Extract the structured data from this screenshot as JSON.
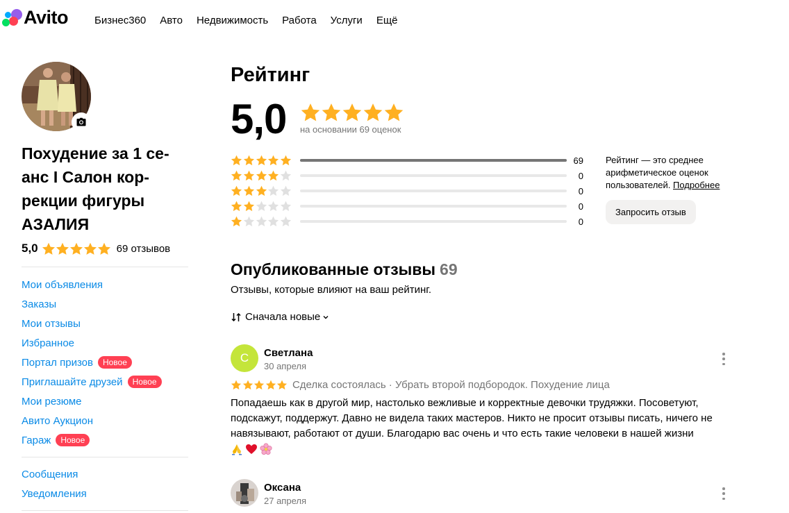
{
  "brand": {
    "logo_text": "Avito"
  },
  "nav": [
    "Бизнес360",
    "Авто",
    "Недвижимость",
    "Работа",
    "Услуги",
    "Ещё"
  ],
  "profile": {
    "title": "Похудение за 1 се-анс I Салон кор-рекции фигуры АЗАЛИЯ",
    "title_lines": [
      "Похудение за 1 се-",
      "анс I Салон кор-",
      "рекции фигуры",
      "АЗАЛИЯ"
    ],
    "rating": "5,0",
    "reviews_label": "69 отзывов"
  },
  "sidebar": {
    "links": [
      {
        "label": "Мои объявления",
        "badge": ""
      },
      {
        "label": "Заказы",
        "badge": ""
      },
      {
        "label": "Мои отзывы",
        "badge": ""
      },
      {
        "label": "Избранное",
        "badge": ""
      },
      {
        "label": "Портал призов",
        "badge": "Новое"
      },
      {
        "label": "Приглашайте друзей",
        "badge": "Новое"
      },
      {
        "label": "Мои резюме",
        "badge": ""
      },
      {
        "label": "Авито Аукцион",
        "badge": ""
      },
      {
        "label": "Гараж",
        "badge": "Новое"
      }
    ],
    "links2": [
      {
        "label": "Сообщения"
      },
      {
        "label": "Уведомления"
      }
    ]
  },
  "rating_block": {
    "heading": "Рейтинг",
    "score": "5,0",
    "based_on": "на основании 69 оценок",
    "distribution": [
      {
        "stars": 5,
        "count": "69",
        "fraction": 1.0
      },
      {
        "stars": 4,
        "count": "0",
        "fraction": 0
      },
      {
        "stars": 3,
        "count": "0",
        "fraction": 0
      },
      {
        "stars": 2,
        "count": "0",
        "fraction": 0
      },
      {
        "stars": 1,
        "count": "0",
        "fraction": 0
      }
    ],
    "note_text": "Рейтинг — это среднее арифметическое оценок пользователей. ",
    "note_link": "Подробнее",
    "request_button": "Запросить отзыв"
  },
  "published": {
    "heading": "Опубликованные отзывы",
    "count": "69",
    "subtitle": "Отзывы, которые влияют на ваш рейтинг.",
    "sort_label": "Сначала новые"
  },
  "reviews": [
    {
      "initial": "С",
      "name": "Светлана",
      "date": "30 апреля",
      "stars": 5,
      "meta": "Сделка состоялась · Убрать второй подбородок. Похудение лица",
      "text": "Попадаешь как в другой мир, настолько вежливые и корректные девочки трудяжки. Посоветуют, подскажут, поддержут. Давно не видела таких мастеров. Никто не просит отзывы писать, ничего не навязывают, работают от души. Благодарю вас очень и что есть такие человеки в нашей жизни",
      "emojis": [
        "folded-hands",
        "red-heart",
        "cherry-blossom"
      ]
    },
    {
      "initial": "",
      "name": "Оксана",
      "date": "27 апреля"
    }
  ],
  "colors": {
    "star": "#ffb021",
    "star_empty": "#e0e0e0",
    "link": "#0a8ae6",
    "badge": "#ff4053",
    "avatar_svetlana": "#c4e53a"
  }
}
